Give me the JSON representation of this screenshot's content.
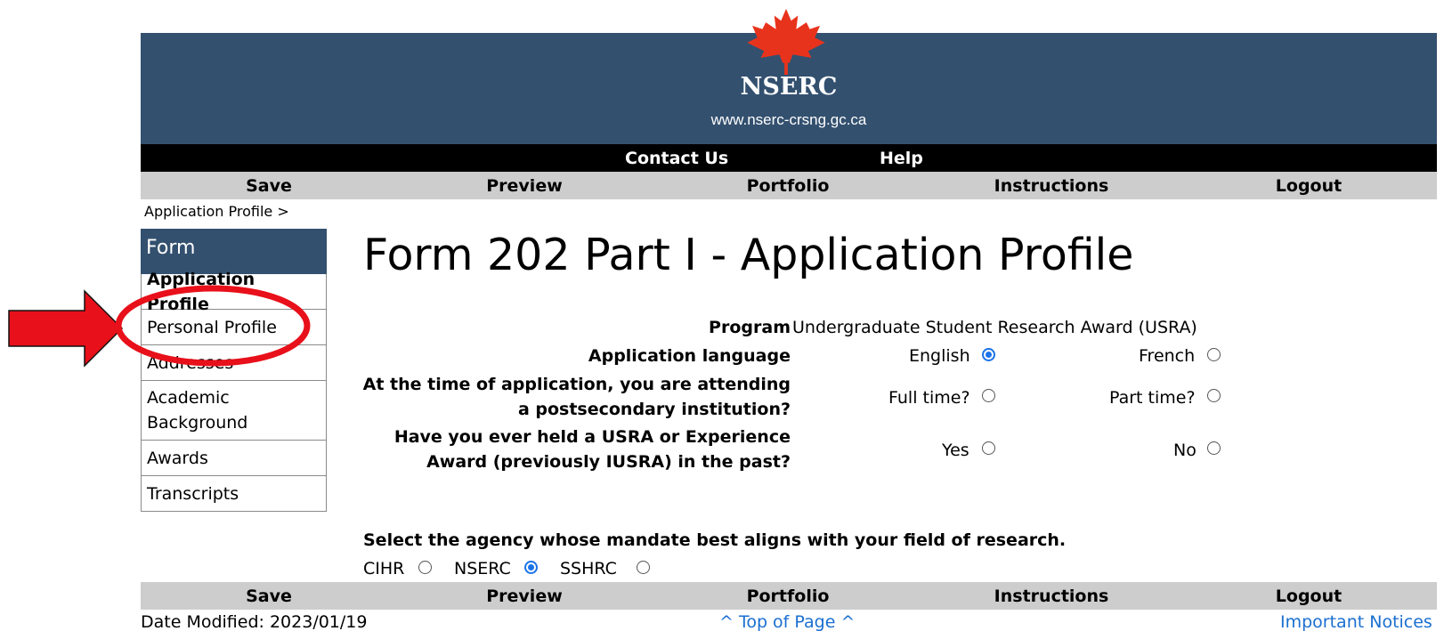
{
  "header": {
    "org_name": "NSERC",
    "url": "www.nserc-crsng.gc.ca",
    "links": [
      "Contact Us",
      "Help"
    ]
  },
  "nav": [
    "Save",
    "Preview",
    "Portfolio",
    "Instructions",
    "Logout"
  ],
  "breadcrumb": "Application Profile >",
  "sidebar": {
    "title": "Form",
    "items": [
      "Application Profile",
      "Personal Profile",
      "Addresses",
      "Academic Background",
      "Awards",
      "Transcripts"
    ],
    "active_index": 0
  },
  "main": {
    "title": "Form 202 Part I - Application Profile",
    "program_label": "Program",
    "program_value": "Undergraduate Student Research Award (USRA)",
    "language_label": "Application language",
    "language_options": [
      "English",
      "French"
    ],
    "language_selected": "English",
    "attendance_label_1": "At the time of application, you are attending",
    "attendance_label_2": "a postsecondary institution?",
    "attendance_options": [
      "Full time?",
      "Part time?"
    ],
    "held_label_1": "Have you ever held a USRA or Experience",
    "held_label_2": "Award (previously IUSRA) in the past?",
    "held_options": [
      "Yes",
      "No"
    ],
    "agency_question": "Select the agency whose mandate best aligns with your field of research.",
    "agency_options": [
      "CIHR",
      "NSERC",
      "SSHRC"
    ],
    "agency_selected": "NSERC"
  },
  "footer": {
    "date_modified": "Date Modified: 2023/01/19",
    "top_link": "^ Top of Page ^",
    "notices_link": "Important Notices"
  },
  "colors": {
    "header_blue": "#33506f",
    "nav_gray": "#cdcdcd",
    "link_blue": "#1a6fd1",
    "annotation_red": "#e8101a"
  }
}
